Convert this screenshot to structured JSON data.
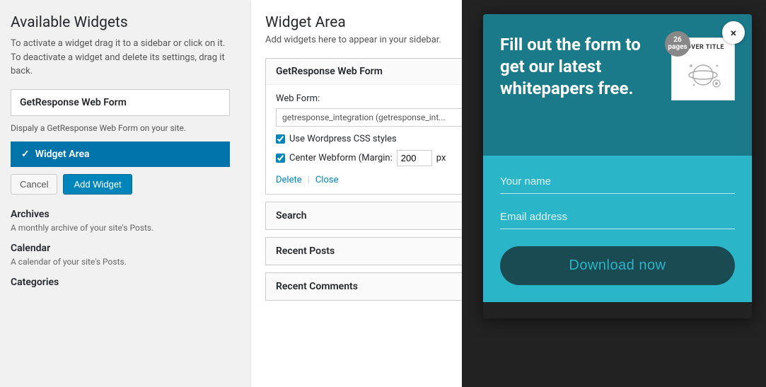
{
  "available_widgets": {
    "title": "Available Widgets",
    "description": "To activate a widget drag it to a sidebar or click on it. To deactivate a widget and delete its settings, drag it back.",
    "widget_item_label": "GetResponse Web Form",
    "widget_item_description": "Dispaly a GetResponse Web Form on your site.",
    "selected_area_label": "Widget Area",
    "btn_cancel": "Cancel",
    "btn_add_widget": "Add Widget",
    "archives_label": "Archives",
    "archives_desc": "A monthly archive of your site's Posts.",
    "calendar_label": "Calendar",
    "calendar_desc": "A calendar of your site's Posts.",
    "categories_label": "Categories"
  },
  "widget_area": {
    "title": "Widget Area",
    "description": "Add widgets here to appear in your sidebar.",
    "expanded_widget": {
      "header": "GetResponse Web Form",
      "web_form_label": "Web Form:",
      "web_form_value": "getresponse_integration (getresponse_int...",
      "checkbox1": "Use Wordpress CSS styles",
      "checkbox2": "Center Webform (Margin:",
      "margin_value": "200",
      "margin_unit": "px",
      "delete_link": "Delete",
      "separator": "|",
      "close_link": "Close"
    },
    "search_widget": "Search",
    "recent_posts_widget": "Recent Posts",
    "recent_comments_widget": "Recent Comments"
  },
  "popup": {
    "close_icon": "×",
    "headline": "Fill out the form to get our latest whitepapers free.",
    "cover_badge_number": "26",
    "cover_badge_unit": "pages",
    "cover_title": "COVER TITLE",
    "name_placeholder": "Your name",
    "email_placeholder": "Email address",
    "download_button": "Download now"
  }
}
